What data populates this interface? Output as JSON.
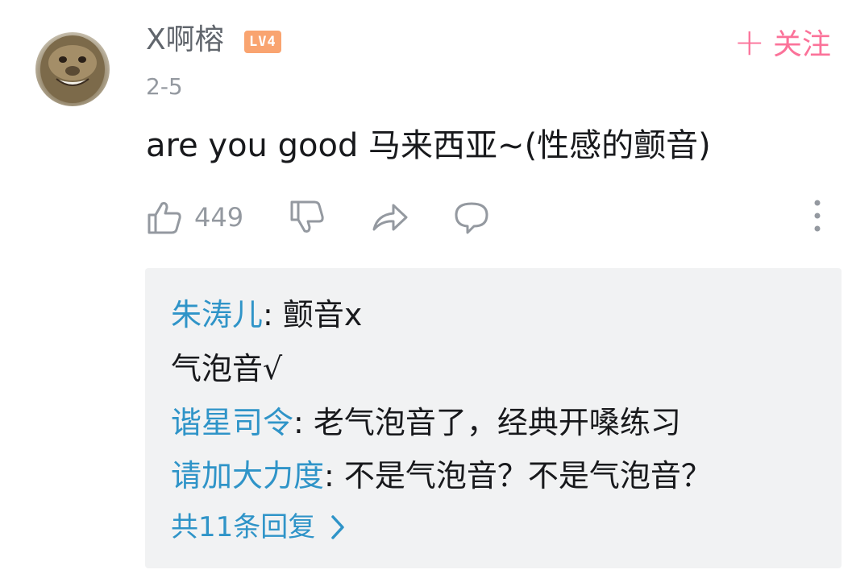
{
  "comment": {
    "username": "X啊榕",
    "level_badge": "LV4",
    "date": "2-5",
    "text": "are you good 马来西亚~(性感的颤音)",
    "like_count": "449",
    "follow_label": "关注",
    "follow_plus": "+",
    "follow_color": "#fb7299",
    "icons": {
      "like": "thumbs-up-icon",
      "dislike": "thumbs-down-icon",
      "share": "share-arrow-icon",
      "reply": "comment-bubble-icon",
      "more": "more-vertical-icon"
    }
  },
  "replies": {
    "items": [
      {
        "author": "朱涛儿",
        "text": ": 颤音x"
      },
      {
        "author": "",
        "text": "气泡音√"
      },
      {
        "author": "谐星司令",
        "text": ": 老气泡音了，经典开嗓练习"
      },
      {
        "author": "请加大力度",
        "text": ": 不是气泡音？不是气泡音？"
      }
    ],
    "more_label": "共11条回复",
    "link_color": "#2f94c8"
  }
}
